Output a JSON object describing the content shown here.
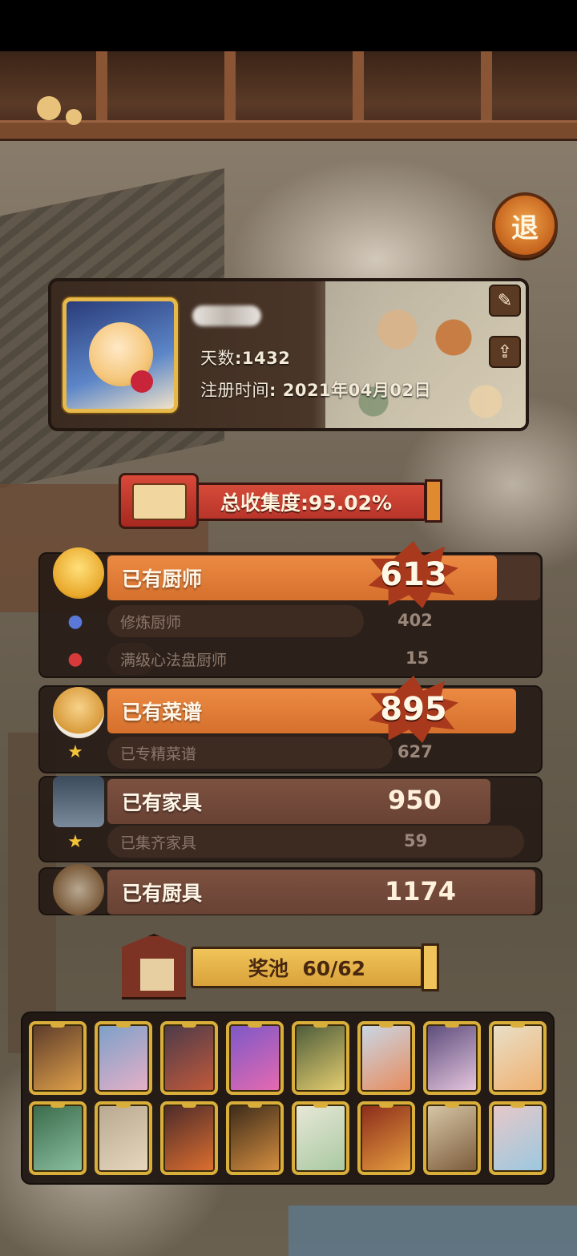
{
  "exit_button": "退",
  "profile": {
    "days_label": "天数",
    "days_value": "1432",
    "register_label": "注册时间",
    "register_value": "2021年04月02日",
    "edit_icon": "✎",
    "share_icon": "⇪"
  },
  "collection": {
    "label": "总收集度:95.02%"
  },
  "chefs": {
    "label": "已有厨师",
    "value": "613",
    "sub": [
      {
        "label": "修炼厨师",
        "value": "402"
      },
      {
        "label": "满级心法盘厨师",
        "value": "15"
      }
    ]
  },
  "recipes": {
    "label": "已有菜谱",
    "value": "895",
    "sub": [
      {
        "label": "已专精菜谱",
        "value": "627"
      }
    ]
  },
  "furniture": {
    "label": "已有家具",
    "value": "950",
    "sub": [
      {
        "label": "已集齐家具",
        "value": "59"
      }
    ]
  },
  "utensils": {
    "label": "已有厨具",
    "value": "1174"
  },
  "prize_pool": {
    "label": "奖池",
    "progress": "60/62",
    "cards": [
      {
        "colors": [
          "#5a3a2a",
          "#e2a24a"
        ]
      },
      {
        "colors": [
          "#7aa0c8",
          "#e8b0c8"
        ]
      },
      {
        "colors": [
          "#4a3a4a",
          "#c45a3a"
        ]
      },
      {
        "colors": [
          "#7a58c8",
          "#e86ab0"
        ]
      },
      {
        "colors": [
          "#4a5a3a",
          "#e8d070"
        ]
      },
      {
        "colors": [
          "#c8d8e8",
          "#e88a5a"
        ]
      },
      {
        "colors": [
          "#5a4a7a",
          "#e8c8e0"
        ]
      },
      {
        "colors": [
          "#e8e0c8",
          "#f0b070"
        ]
      },
      {
        "colors": [
          "#3a6a4a",
          "#8ac0a0"
        ]
      },
      {
        "colors": [
          "#b8a890",
          "#e8d8c0"
        ]
      },
      {
        "colors": [
          "#4a2a2a",
          "#e07030"
        ]
      },
      {
        "colors": [
          "#3a2a1a",
          "#d89040"
        ]
      },
      {
        "colors": [
          "#e8e8d8",
          "#a8c8a0"
        ]
      },
      {
        "colors": [
          "#8a2a1a",
          "#e8a040"
        ]
      },
      {
        "colors": [
          "#d8c8a8",
          "#7a5a3a"
        ]
      },
      {
        "colors": [
          "#e8c8c8",
          "#9ac8e0"
        ]
      }
    ]
  }
}
